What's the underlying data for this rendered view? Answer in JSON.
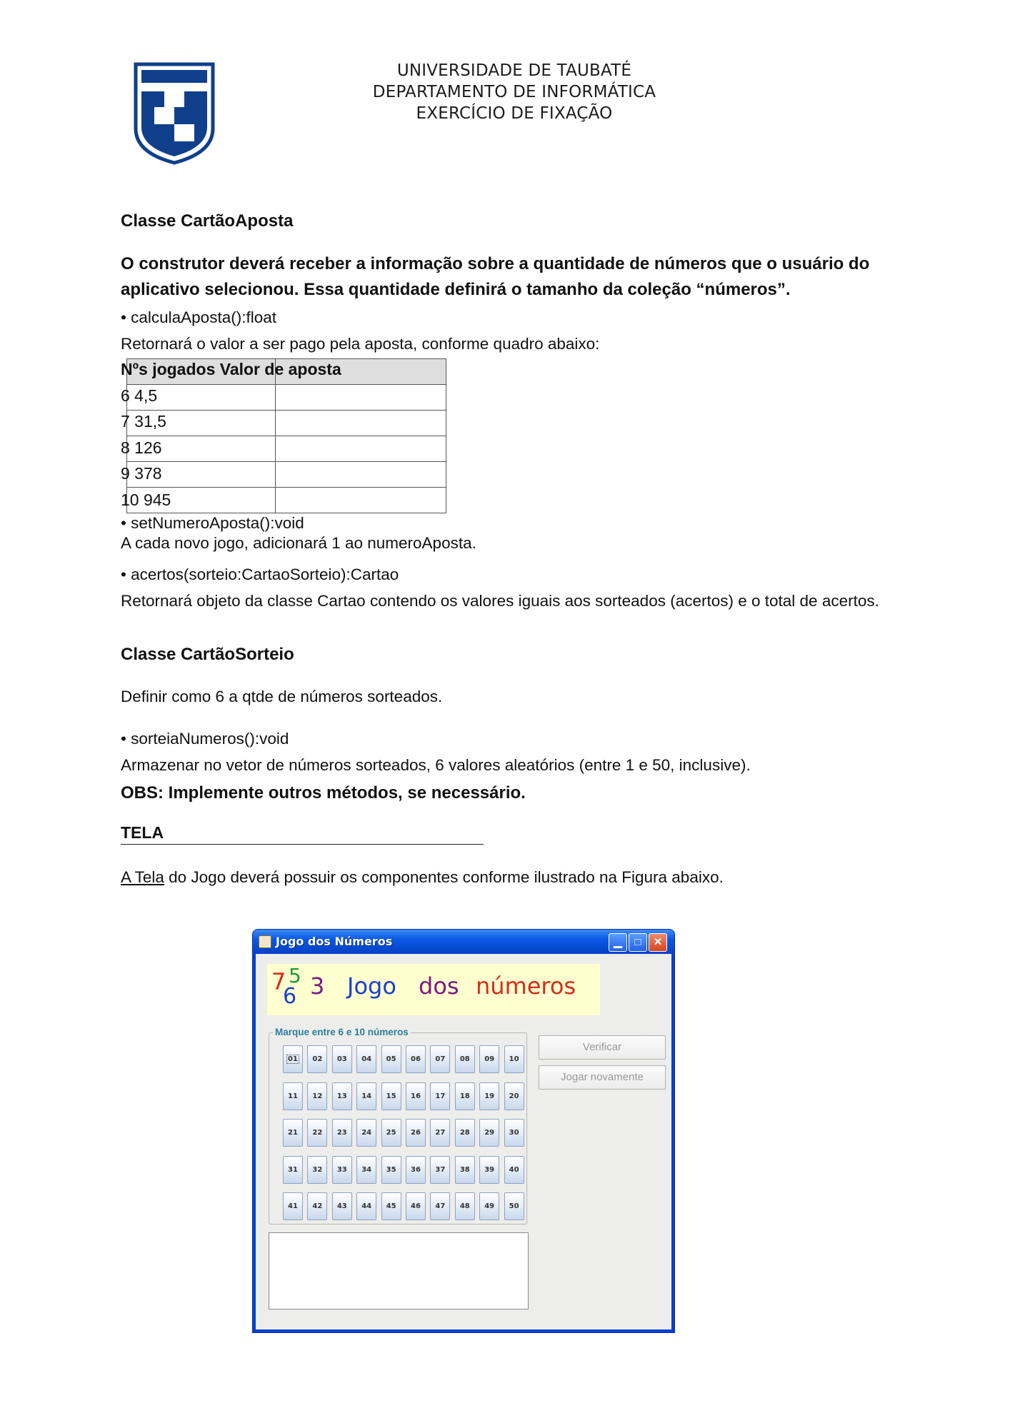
{
  "header": {
    "line1": "UNIVERSIDADE DE TAUBATÉ",
    "line2": "DEPARTAMENTO DE INFORMÁTICA",
    "line3": "EXERCÍCIO DE FIXAÇÃO"
  },
  "colors": {
    "logo_blue": "#0f3f8a"
  },
  "section1": {
    "title": "Classe CartãoAposta",
    "constructor": "O construtor deverá receber a informação sobre a quantidade de números que o usuário do aplicativo selecionou. Essa quantidade definirá o tamanho da coleção “números”.",
    "method1": "• calculaAposta():float",
    "method1_desc": "Retornará o valor a ser pago pela aposta, conforme quadro abaixo:",
    "table_header": "Nºs jogados Valor de aposta",
    "table_rows": [
      "6 4,5",
      "7 31,5",
      "8 126",
      "9 378",
      "10 945"
    ],
    "method2": "• setNumeroAposta():void",
    "method2_desc": "A cada novo jogo, adicionará 1 ao numeroAposta.",
    "method3": "• acertos(sorteio:CartaoSorteio):Cartao",
    "method3_desc": "Retornará objeto da classe Cartao contendo os valores iguais aos sorteados (acertos) e o total de acertos."
  },
  "section2": {
    "title": "Classe CartãoSorteio",
    "desc": "Definir como 6 a qtde de números sorteados.",
    "method1": "• sorteiaNumeros():void",
    "method1_desc": "Armazenar no vetor de números sorteados, 6 valores aleatórios (entre 1 e 50, inclusive).",
    "obs": "OBS: Implemente outros métodos, se necessário."
  },
  "tela": {
    "title": "TELA",
    "desc_link": "A Tela",
    "desc_rest": " do Jogo deverá possuir os componentes conforme ilustrado na Figura abaixo."
  },
  "window": {
    "title": "Jogo dos Números",
    "banner": {
      "d7": "7",
      "d5": "5",
      "d6": "6",
      "d3": "3",
      "w1": "Jogo",
      "w2": "dos",
      "w3": "números"
    },
    "group_label": "Marque entre 6 e 10 números",
    "numbers": [
      "01",
      "02",
      "03",
      "04",
      "05",
      "06",
      "07",
      "08",
      "09",
      "10",
      "11",
      "12",
      "13",
      "14",
      "15",
      "16",
      "17",
      "18",
      "19",
      "20",
      "21",
      "22",
      "23",
      "24",
      "25",
      "26",
      "27",
      "28",
      "29",
      "30",
      "31",
      "32",
      "33",
      "34",
      "35",
      "36",
      "37",
      "38",
      "39",
      "40",
      "41",
      "42",
      "43",
      "44",
      "45",
      "46",
      "47",
      "48",
      "49",
      "50"
    ],
    "verify_button": "Verificar",
    "replay_button": "Jogar novamente",
    "output_text": ""
  }
}
